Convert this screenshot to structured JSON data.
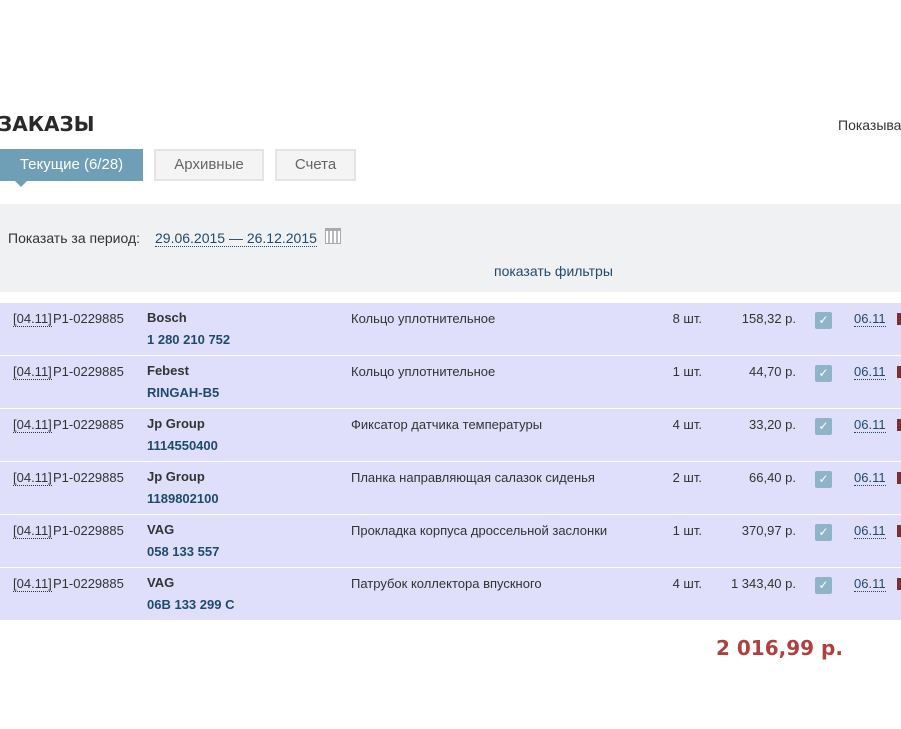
{
  "page": {
    "title": "ЗАКАЗЫ",
    "show_hint": "Показыва"
  },
  "tabs": [
    {
      "label": "Текущие (6/28)",
      "active": true
    },
    {
      "label": "Архивные"
    },
    {
      "label": "Счета"
    }
  ],
  "filter": {
    "period_label": "Показать за период:",
    "period_value": "29.06.2015 — 26.12.2015",
    "calendar_icon": "calendar-icon",
    "show_filters": "показать фильтры"
  },
  "orders": [
    {
      "date": "[04.11]",
      "order": "P1-0229885",
      "brand": "Bosch",
      "article": "1 280 210 752",
      "description": "Кольцо уплотнительное",
      "qty": "8 шт.",
      "price": "158,32 р.",
      "checked": true,
      "delivery": "06.11"
    },
    {
      "date": "[04.11]",
      "order": "P1-0229885",
      "brand": "Febest",
      "article": "RINGAH-B5",
      "description": "Кольцо уплотнительное",
      "qty": "1 шт.",
      "price": "44,70 р.",
      "checked": true,
      "delivery": "06.11"
    },
    {
      "date": "[04.11]",
      "order": "P1-0229885",
      "brand": "Jp Group",
      "article": "1114550400",
      "description": "Фиксатор датчика температуры",
      "qty": "4 шт.",
      "price": "33,20 р.",
      "checked": true,
      "delivery": "06.11"
    },
    {
      "date": "[04.11]",
      "order": "P1-0229885",
      "brand": "Jp Group",
      "article": "1189802100",
      "description": "Планка направляющая салазок сиденья",
      "qty": "2 шт.",
      "price": "66,40 р.",
      "checked": true,
      "delivery": "06.11"
    },
    {
      "date": "[04.11]",
      "order": "P1-0229885",
      "brand": "VAG",
      "article": "058 133 557",
      "description": "Прокладка корпуса дроссельной заслонки",
      "qty": "1 шт.",
      "price": "370,97 р.",
      "checked": true,
      "delivery": "06.11"
    },
    {
      "date": "[04.11]",
      "order": "P1-0229885",
      "brand": "VAG",
      "article": "06B 133 299 C",
      "description": "Патрубок коллектора впускного",
      "qty": "4 шт.",
      "price": "1 343,40 р.",
      "checked": true,
      "delivery": "06.11"
    }
  ],
  "total": "2 016,99 р.",
  "colors": {
    "tab_active": "#6f9fb6",
    "row_bg": "#dfdffb",
    "total": "#b04040",
    "link": "#1f4a6e"
  }
}
